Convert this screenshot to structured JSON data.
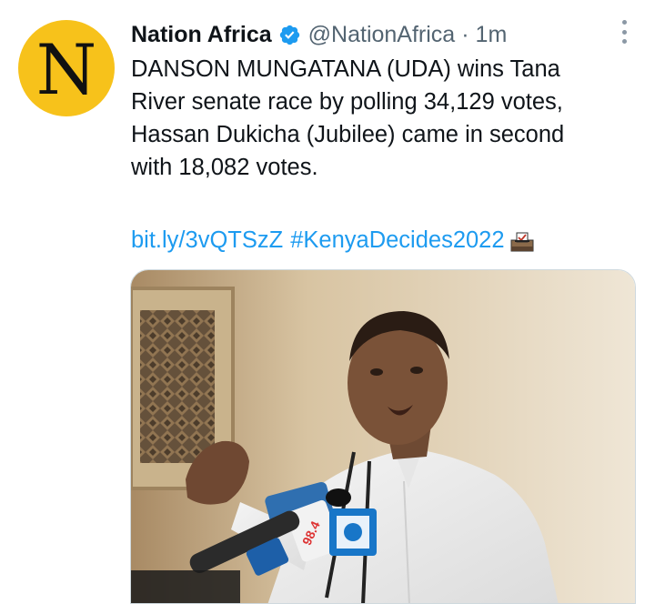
{
  "account": {
    "avatar_letter": "N",
    "display_name": "Nation Africa",
    "handle": "@NationAfrica",
    "separator": "·",
    "timestamp": "1m",
    "verified": true
  },
  "tweet": {
    "text_lines": [
      "DANSON MUNGATANA (UDA) wins Tana",
      "River senate race by polling 34,129 votes,",
      "Hassan Dukicha (Jubilee) came in second",
      "with 18,082 votes."
    ],
    "link": "bit.ly/3vQTSzZ",
    "hashtag": "#KenyaDecides2022",
    "emoji": "ballot-box-icon"
  },
  "colors": {
    "accent": "#1d9bf0",
    "avatar_bg": "#f7c21b",
    "secondary_text": "#536471"
  }
}
